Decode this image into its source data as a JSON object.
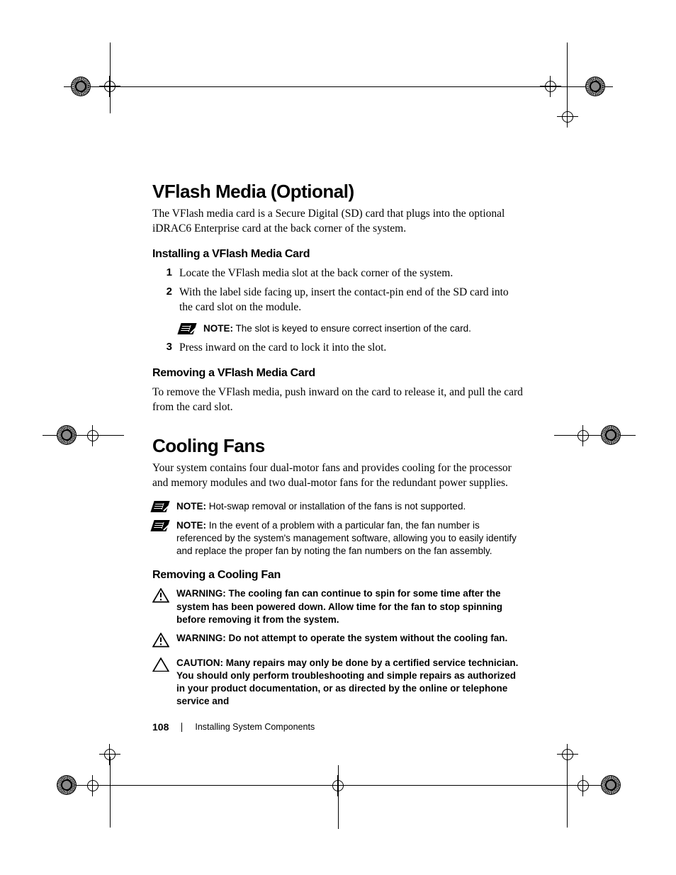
{
  "sections": {
    "vflash": {
      "heading": "VFlash Media (Optional)",
      "intro": "The VFlash media card is a Secure Digital (SD) card that plugs into the optional iDRAC6 Enterprise card at the back corner of the system.",
      "install": {
        "heading": "Installing a VFlash Media Card",
        "steps": [
          "Locate the VFlash media slot at the back corner of the system.",
          "With the label side facing up, insert the contact-pin end of the SD card into the card slot on the module.",
          "Press inward on the card to lock it into the slot."
        ],
        "note_after_step2": {
          "label": "NOTE:",
          "text": "The slot is keyed to ensure correct insertion of the card."
        }
      },
      "remove": {
        "heading": "Removing a VFlash Media Card",
        "text": "To remove the VFlash media, push inward on the card to release it, and pull the card from the card slot."
      }
    },
    "cooling": {
      "heading": "Cooling Fans",
      "intro": "Your system contains four dual-motor fans and provides cooling for the processor and memory modules and two dual-motor fans for the redundant power supplies.",
      "note1": {
        "label": "NOTE:",
        "text": "Hot-swap removal or installation of the fans is not supported."
      },
      "note2": {
        "label": "NOTE:",
        "text": "In the event of a problem with a particular fan, the fan number is referenced by the system's management software, allowing you to easily identify and replace the proper fan by noting the fan numbers on the fan assembly."
      },
      "remove": {
        "heading": "Removing a Cooling Fan",
        "warn1": {
          "label": "WARNING:",
          "text": "The cooling fan can continue to spin for some time after the system has been powered down. Allow time for the fan to stop spinning before removing it from the system."
        },
        "warn2": {
          "label": "WARNING:",
          "text": "Do not attempt to operate the system without the cooling fan."
        },
        "caution": {
          "label": "CAUTION:",
          "text": "Many repairs may only be done by a certified service technician. You should only perform troubleshooting and simple repairs as authorized in your product documentation, or as directed by the online or telephone service and"
        }
      }
    }
  },
  "footer": {
    "page_number": "108",
    "section_title": "Installing System Components"
  }
}
